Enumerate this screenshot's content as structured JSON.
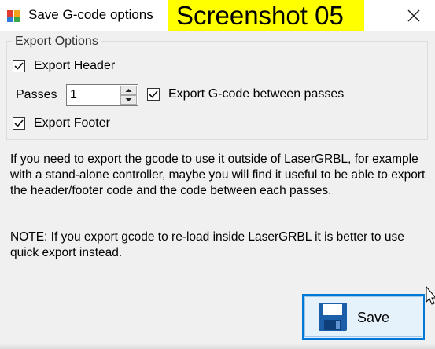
{
  "window": {
    "title": "Save G-code options",
    "caption_overlay": "Screenshot 05",
    "close_glyph": "✕"
  },
  "export_options": {
    "legend": "Export Options",
    "export_header": {
      "label": "Export Header",
      "checked": true
    },
    "passes": {
      "label": "Passes",
      "value": "1"
    },
    "export_between_passes": {
      "label": "Export G-code between passes",
      "checked": true
    },
    "export_footer": {
      "label": "Export Footer",
      "checked": true
    }
  },
  "description": {
    "paragraph1": "If you need to export the gcode to use it outside of LaserGRBL, for example with a stand-alone controller, maybe you will find it useful to be able to export the header/footer code and the code between each passes.",
    "paragraph2": "NOTE: If you export gcode to re-load inside LaserGRBL it is better to use quick export instead."
  },
  "actions": {
    "save_label": "Save"
  },
  "icons": {
    "app": "app-icon",
    "close": "close-icon",
    "save": "floppy-disk-icon",
    "spin_up": "spin-up-icon",
    "spin_down": "spin-down-icon",
    "check": "check-icon",
    "cursor": "mouse-cursor-icon"
  },
  "colors": {
    "accent": "#0078d7",
    "caption_highlight": "#ffff00",
    "window_bg": "#f0f0f0",
    "floppy": "#1d5ea8"
  }
}
